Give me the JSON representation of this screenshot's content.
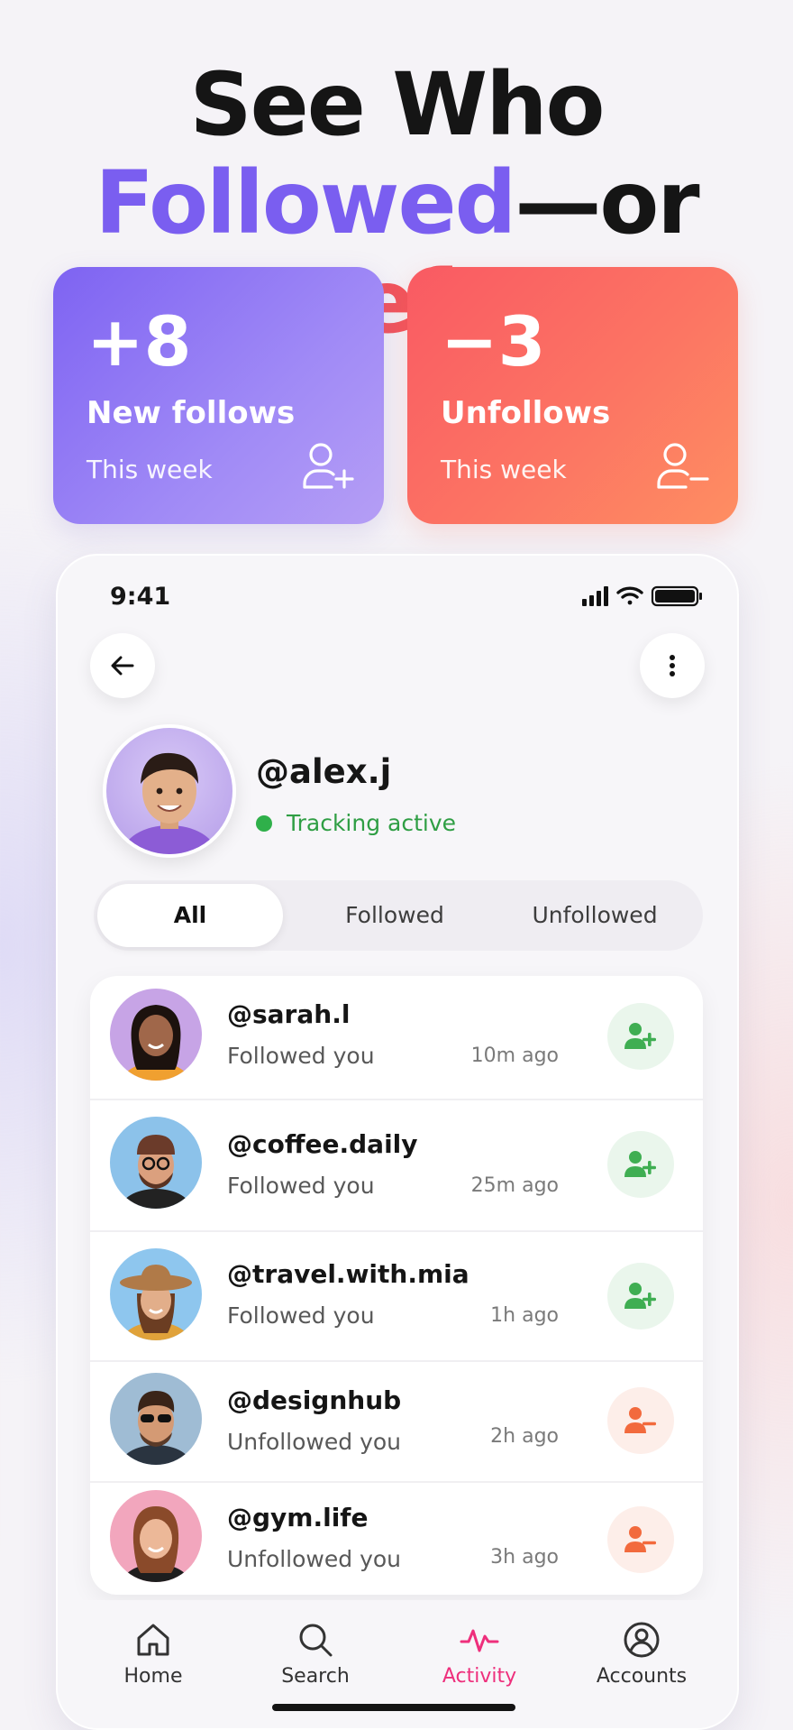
{
  "headline": {
    "line1": "See Who",
    "followed": "Followed",
    "dash_or": "—or ",
    "left": "Left"
  },
  "stats": {
    "follows": {
      "number": "+8",
      "title": "New follows",
      "subtitle": "This week",
      "icon": "user-plus-icon"
    },
    "unfollows": {
      "number": "−3",
      "title": "Unfollows",
      "subtitle": "This week",
      "icon": "user-minus-icon"
    }
  },
  "status_bar": {
    "time": "9:41"
  },
  "profile": {
    "handle": "@alex.j",
    "status": "Tracking active"
  },
  "filter_tabs": [
    {
      "label": "All",
      "selected": true
    },
    {
      "label": "Followed",
      "selected": false
    },
    {
      "label": "Unfollowed",
      "selected": false
    }
  ],
  "activity": [
    {
      "handle": "@sarah.l",
      "status": "Followed you",
      "time": "10m ago",
      "type": "follow",
      "icon": "user-plus-icon"
    },
    {
      "handle": "@coffee.daily",
      "status": "Followed you",
      "time": "25m ago",
      "type": "follow",
      "icon": "user-plus-icon"
    },
    {
      "handle": "@travel.with.mia",
      "status": "Followed you",
      "time": "1h ago",
      "type": "follow",
      "icon": "user-plus-icon"
    },
    {
      "handle": "@designhub",
      "status": "Unfollowed you",
      "time": "2h ago",
      "type": "unfollow",
      "icon": "user-minus-icon"
    },
    {
      "handle": "@gym.life",
      "status": "Unfollowed you",
      "time": "3h ago",
      "type": "unfollow",
      "icon": "user-minus-icon"
    }
  ],
  "nav": [
    {
      "label": "Home",
      "icon": "home-icon",
      "active": false
    },
    {
      "label": "Search",
      "icon": "search-icon",
      "active": false
    },
    {
      "label": "Activity",
      "icon": "activity-icon",
      "active": true
    },
    {
      "label": "Accounts",
      "icon": "account-icon",
      "active": false
    }
  ],
  "colors": {
    "accent_purple": "#7a5ef0",
    "accent_red": "#f2545b",
    "follow_green": "#3fae52",
    "unfollow_orange": "#f26a3d",
    "active_tab": "#ee2f7c",
    "tracking_green": "#2f9e44"
  }
}
